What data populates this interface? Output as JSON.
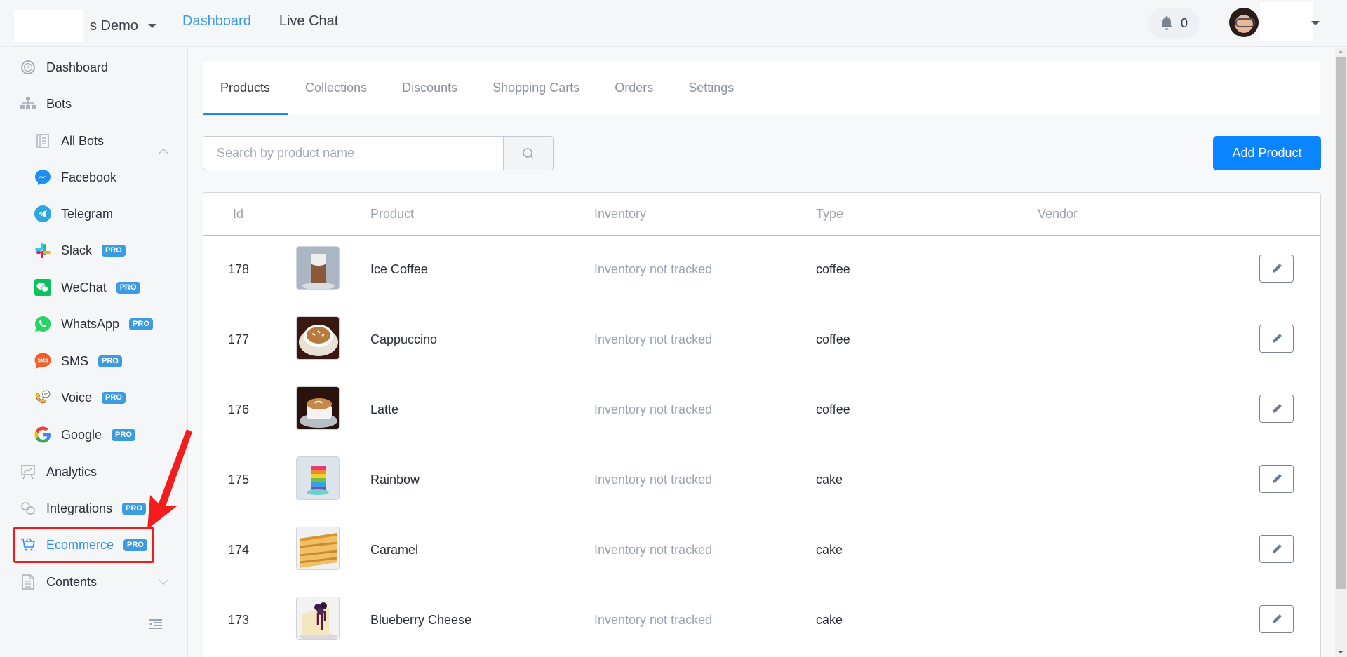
{
  "header": {
    "brand_name": "s Demo",
    "nav": [
      {
        "label": "Dashboard",
        "active": true
      },
      {
        "label": "Live Chat",
        "active": false
      }
    ],
    "notifications_count": "0"
  },
  "sidebar": {
    "items": [
      {
        "label": "Dashboard",
        "icon": "gauge-icon"
      },
      {
        "label": "Bots",
        "icon": "sitemap-icon",
        "expanded": true
      },
      {
        "label": "All Bots",
        "icon": "list-icon"
      },
      {
        "label": "Facebook",
        "icon": "messenger-icon"
      },
      {
        "label": "Telegram",
        "icon": "telegram-icon"
      },
      {
        "label": "Slack",
        "icon": "slack-icon",
        "badge": "PRO"
      },
      {
        "label": "WeChat",
        "icon": "wechat-icon",
        "badge": "PRO"
      },
      {
        "label": "WhatsApp",
        "icon": "whatsapp-icon",
        "badge": "PRO"
      },
      {
        "label": "SMS",
        "icon": "sms-icon",
        "badge": "PRO"
      },
      {
        "label": "Voice",
        "icon": "voice-icon",
        "badge": "PRO"
      },
      {
        "label": "Google",
        "icon": "google-icon",
        "badge": "PRO"
      },
      {
        "label": "Analytics",
        "icon": "analytics-icon"
      },
      {
        "label": "Integrations",
        "icon": "integrations-icon",
        "badge": "PRO"
      },
      {
        "label": "Ecommerce",
        "icon": "cart-icon",
        "badge": "PRO",
        "active": true
      },
      {
        "label": "Contents",
        "icon": "document-icon",
        "expanded": false
      }
    ]
  },
  "tabs": [
    {
      "label": "Products",
      "active": true
    },
    {
      "label": "Collections"
    },
    {
      "label": "Discounts"
    },
    {
      "label": "Shopping Carts"
    },
    {
      "label": "Orders"
    },
    {
      "label": "Settings"
    }
  ],
  "search": {
    "placeholder": "Search by product name",
    "value": ""
  },
  "add_product_label": "Add Product",
  "colors": {
    "accent": "#0a84ff",
    "active_nav": "#3d9be0",
    "pro_badge": "#3d9be0",
    "annotation": "#ef1c1c"
  },
  "table": {
    "columns": [
      "Id",
      "Product",
      "Inventory",
      "Type",
      "Vendor"
    ],
    "rows": [
      {
        "id": "178",
        "product": "Ice Coffee",
        "inventory": "Inventory not tracked",
        "type": "coffee",
        "vendor": "",
        "thumb": "ice-coffee"
      },
      {
        "id": "177",
        "product": "Cappuccino",
        "inventory": "Inventory not tracked",
        "type": "coffee",
        "vendor": "",
        "thumb": "cappuccino"
      },
      {
        "id": "176",
        "product": "Latte",
        "inventory": "Inventory not tracked",
        "type": "coffee",
        "vendor": "",
        "thumb": "latte"
      },
      {
        "id": "175",
        "product": "Rainbow",
        "inventory": "Inventory not tracked",
        "type": "cake",
        "vendor": "",
        "thumb": "rainbow"
      },
      {
        "id": "174",
        "product": "Caramel",
        "inventory": "Inventory not tracked",
        "type": "cake",
        "vendor": "",
        "thumb": "caramel"
      },
      {
        "id": "173",
        "product": "Blueberry Cheese",
        "inventory": "Inventory not tracked",
        "type": "cake",
        "vendor": "",
        "thumb": "blueberry"
      }
    ]
  }
}
